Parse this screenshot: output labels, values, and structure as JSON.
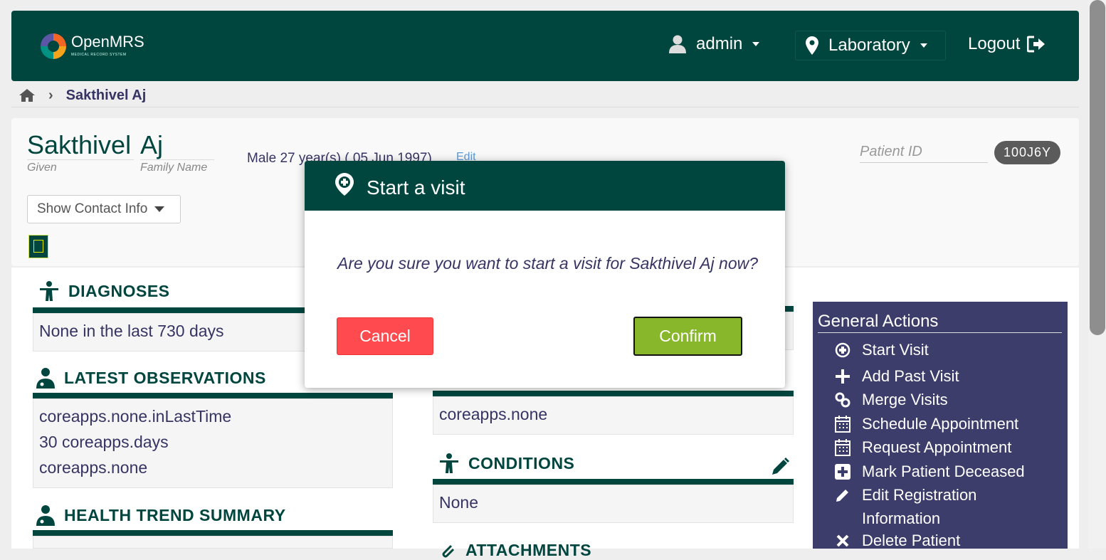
{
  "header": {
    "logo_text": "OpenMRS",
    "logo_subtitle": "MEDICAL RECORD SYSTEM",
    "user": "admin",
    "location": "Laboratory",
    "logout": "Logout"
  },
  "breadcrumb": {
    "patient": "Sakthivel Aj"
  },
  "patient": {
    "given_name": "Sakthivel",
    "family_name": "Aj",
    "given_label": "Given",
    "family_label": "Family Name",
    "gender_age": "Male  27 year(s) ( 05 Jun 1997)",
    "edit": "Edit",
    "patient_id_label": "Patient ID",
    "patient_id": "100J6Y",
    "show_contact": "Show Contact Info"
  },
  "sections": {
    "diagnoses": {
      "title": "DIAGNOSES",
      "body": "None in the last 730 days"
    },
    "observations": {
      "title": "LATEST OBSERVATIONS",
      "lines": [
        "coreapps.none.inLastTime",
        "30 coreapps.days",
        "coreapps.none"
      ]
    },
    "health_trend": {
      "title": "HEALTH TREND SUMMARY"
    },
    "middle_body": "coreapps.none",
    "conditions": {
      "title": "CONDITIONS",
      "body": "None"
    },
    "attachments": {
      "title": "ATTACHMENTS"
    }
  },
  "general_actions": {
    "title": "General Actions",
    "items": [
      "Start Visit",
      "Add Past Visit",
      "Merge Visits",
      "Schedule Appointment",
      "Request Appointment",
      "Mark Patient Deceased",
      "Edit Registration",
      "Information",
      "Delete Patient"
    ]
  },
  "modal": {
    "title": "Start a visit",
    "message": "Are you sure you want to start a visit for Sakthivel Aj now?",
    "cancel": "Cancel",
    "confirm": "Confirm"
  },
  "colors": {
    "primary": "#00463f",
    "actions_bg": "#3d3d6b",
    "cancel": "#ff4a4f",
    "confirm": "#88b72c"
  }
}
